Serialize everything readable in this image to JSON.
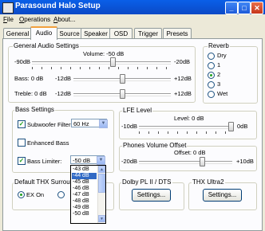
{
  "window": {
    "title": "Parasound Halo Setup",
    "minimize": "_",
    "maximize": "□",
    "close": "✕"
  },
  "menu": [
    {
      "label": "File",
      "key": "F",
      "rest": "ile"
    },
    {
      "label": "Operations",
      "key": "O",
      "rest": "perations"
    },
    {
      "label": "About...",
      "key": "A",
      "rest": "bout..."
    }
  ],
  "tabs": [
    "General",
    "Audio",
    "Source",
    "Speaker",
    "OSD",
    "Trigger",
    "Presets"
  ],
  "active_tab": "Audio",
  "general_audio": {
    "title": "General Audio Settings",
    "volume": {
      "label": "Volume: -50 dB",
      "min": "-90dB",
      "max": "-20dB",
      "value_fraction": 0.57
    },
    "bass": {
      "label": "Bass: 0 dB",
      "min": "-12dB",
      "max": "+12dB",
      "value_fraction": 0.5
    },
    "treble": {
      "label": "Treble: 0 dB",
      "min": "-12dB",
      "max": "+12dB",
      "value_fraction": 0.5
    }
  },
  "reverb": {
    "title": "Reverb",
    "options": [
      "Dry",
      "1",
      "2",
      "3",
      "Wet"
    ],
    "selected": "2"
  },
  "bass_settings": {
    "title": "Bass Settings",
    "subwoofer_filter": {
      "label": "Subwoofer Filter:",
      "checked": true,
      "value": "60 Hz"
    },
    "enhanced_bass": {
      "label": "Enhanced Bass",
      "checked": false
    },
    "bass_limiter": {
      "label": "Bass Limiter:",
      "checked": true,
      "value": "-50 dB"
    }
  },
  "lfe_level": {
    "title": "LFE Level",
    "label": "Level: 0 dB",
    "min": "-10dB",
    "max": "0dB",
    "value_fraction": 1.0
  },
  "phones_offset": {
    "title": "Phones Volume Offset",
    "label": "Offset: 0 dB",
    "min": "-20dB",
    "max": "+10dB",
    "value_fraction": 0.67
  },
  "thx_surround": {
    "title": "Default THX Surround",
    "option_on": "EX On",
    "selected": "EX On"
  },
  "dolby": {
    "title": "Dolby PL II / DTS",
    "button": "Settings..."
  },
  "thx_ultra": {
    "title": "THX Ultra2",
    "button": "Settings..."
  },
  "limiter_dropdown": {
    "options": [
      "-43 dB",
      "-44 dB",
      "-45 dB",
      "-46 dB",
      "-47 dB",
      "-48 dB",
      "-49 dB",
      "-50 dB"
    ],
    "highlighted": "-44 dB"
  }
}
